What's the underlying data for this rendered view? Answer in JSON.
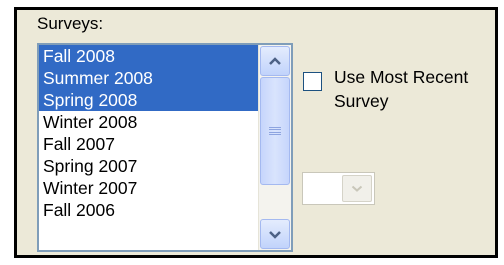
{
  "surveys": {
    "label": "Surveys:",
    "items": [
      {
        "label": "Fall 2008",
        "selected": true
      },
      {
        "label": "Summer 2008",
        "selected": true
      },
      {
        "label": "Spring 2008",
        "selected": true
      },
      {
        "label": "Winter 2008",
        "selected": false
      },
      {
        "label": "Fall 2007",
        "selected": false
      },
      {
        "label": "Spring 2007",
        "selected": false
      },
      {
        "label": "Winter 2007",
        "selected": false
      },
      {
        "label": "Fall 2006",
        "selected": false
      }
    ],
    "scrollbar": {
      "up_icon": "chevron-up-icon",
      "down_icon": "chevron-down-icon"
    }
  },
  "use_most_recent": {
    "label": "Use Most Recent Survey",
    "checked": false
  },
  "survey_dropdown": {
    "value": "",
    "enabled": false,
    "arrow_icon": "chevron-down-icon"
  },
  "colors": {
    "panel_background": "#ece9d8",
    "selection": "#316ac5",
    "scroll_arrow": "#4d6185",
    "disabled_arrow": "#c9c7ba"
  }
}
